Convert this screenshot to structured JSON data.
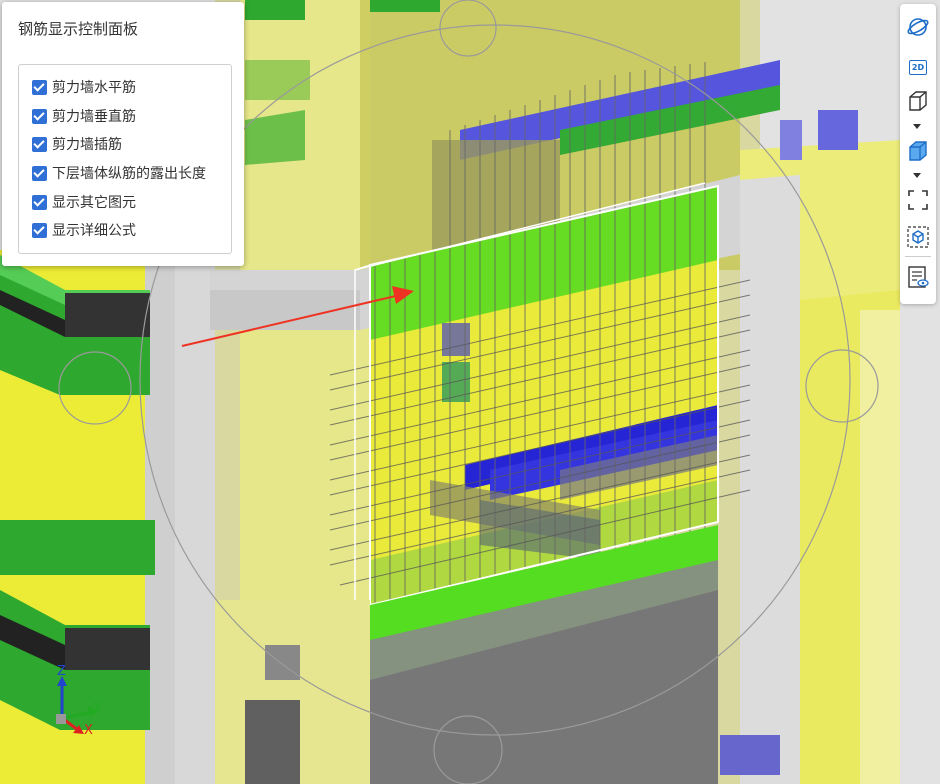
{
  "panel": {
    "title": "钢筋显示控制面板",
    "options": [
      {
        "label": "剪力墙水平筋",
        "checked": true
      },
      {
        "label": "剪力墙垂直筋",
        "checked": true
      },
      {
        "label": "剪力墙插筋",
        "checked": true
      },
      {
        "label": "下层墙体纵筋的露出长度",
        "checked": true
      },
      {
        "label": "显示其它图元",
        "checked": true
      },
      {
        "label": "显示详细公式",
        "checked": true
      }
    ]
  },
  "toolbar": {
    "items": [
      {
        "icon": "orbit-icon"
      },
      {
        "icon": "2d-view-icon",
        "label": "2D"
      },
      {
        "icon": "wireframe-cube-icon"
      },
      {
        "icon": "solid-cube-icon"
      },
      {
        "icon": "fit-view-icon"
      },
      {
        "icon": "cube-selection-icon"
      },
      {
        "icon": "property-view-icon"
      }
    ]
  },
  "axes": {
    "x": "X",
    "y": "Y",
    "z": "Z"
  },
  "colors": {
    "wall_yellow": "#e8e83a",
    "slab_green": "#33cc33",
    "beam_blue": "#3333dd",
    "highlight_green": "#66dd22",
    "annotation_arrow": "#ee3322",
    "checkbox": "#2f6fd6"
  }
}
